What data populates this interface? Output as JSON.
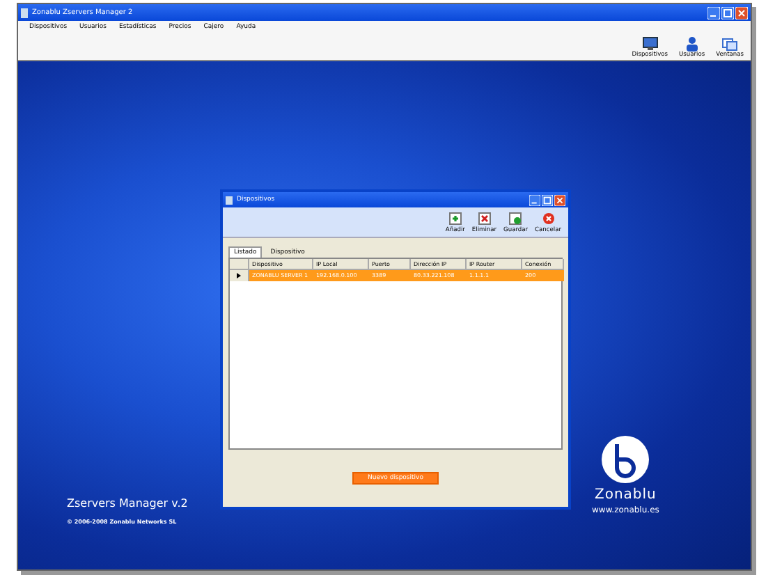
{
  "window": {
    "title": "Zonablu Zservers Manager 2"
  },
  "menu": [
    "Dispositivos",
    "Usuarios",
    "Estadísticas",
    "Precios",
    "Cajero",
    "Ayuda"
  ],
  "toolbar": [
    "Dispositivos",
    "Usuarios",
    "Ventanas"
  ],
  "dialog": {
    "title": "Dispositivos",
    "toolbar": [
      "Añadir",
      "Eliminar",
      "Guardar",
      "Cancelar"
    ],
    "tabs": [
      {
        "label": "Listado",
        "selected": true
      },
      {
        "label": "Dispositivo",
        "selected": false
      }
    ],
    "table": {
      "columns": [
        "Dispositivo",
        "IP Local",
        "Puerto",
        "Dirección IP",
        "IP Router",
        "Conexión"
      ],
      "rows": [
        {
          "cells": [
            "ZONABLU SERVER 1",
            "192.168.0.100",
            "3389",
            "80.33.221.108",
            "1.1.1.1",
            "200"
          ],
          "selected": true
        }
      ]
    },
    "button": "Nuevo dispositivo"
  },
  "product": {
    "name": "Zservers Manager v.2",
    "copyright": "© 2006-2008 Zonablu Networks SL"
  },
  "logo": {
    "name": "Zonablu",
    "url": "www.zonablu.es"
  }
}
